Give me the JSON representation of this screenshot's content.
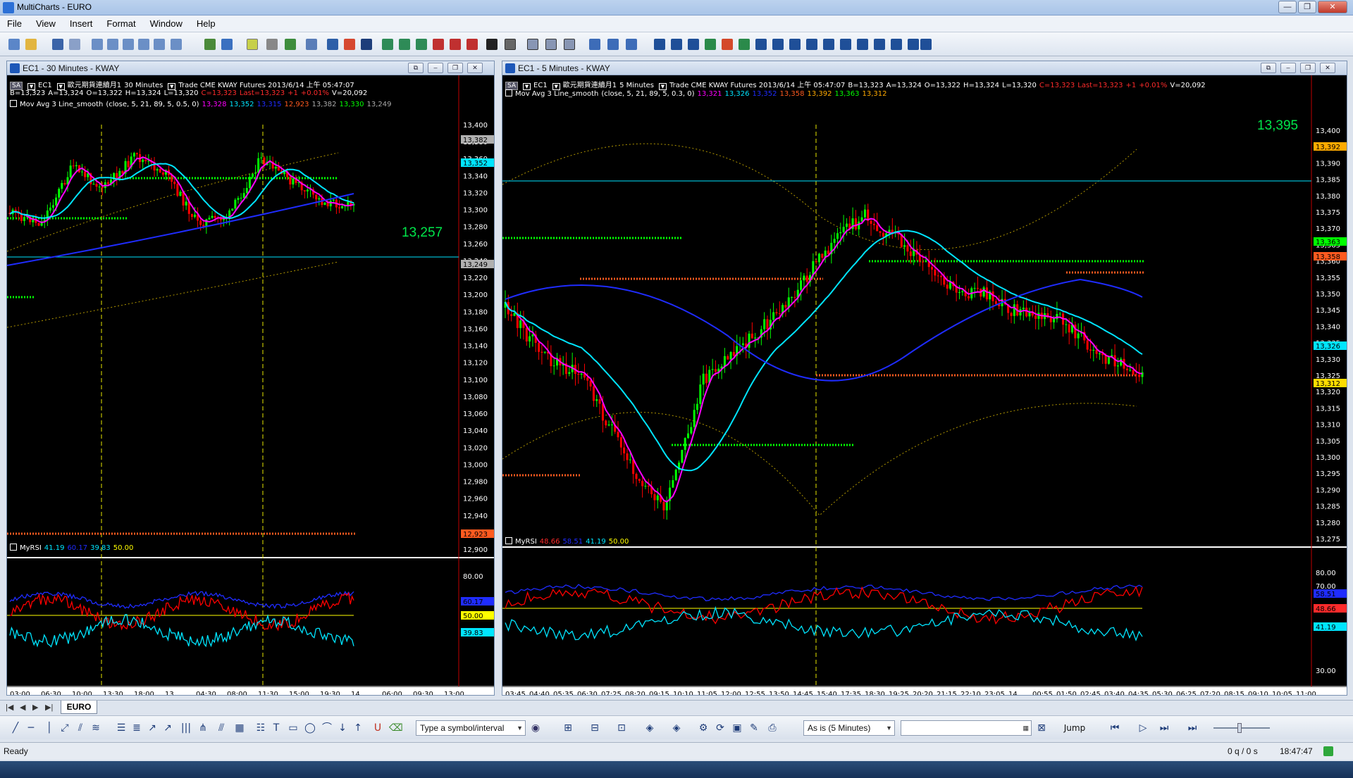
{
  "app": {
    "title": "MultiCharts - EURO"
  },
  "menu": [
    "File",
    "View",
    "Insert",
    "Format",
    "Window",
    "Help"
  ],
  "colors": {
    "chart_bg": "#000000",
    "price_up": "#00ff00",
    "price_down": "#ff0000",
    "ma_fast": "#ff00ff",
    "ma_mid": "#00e5ff",
    "ma_slow": "#1f2cff",
    "highlight_line": "#00ff00",
    "orange_line": "#ff5a1f",
    "dotted_band": "#b09600",
    "rsi_level": "#ffff00"
  },
  "left_chart": {
    "window_title": "EC1 - 30 Minutes - KWAY",
    "header_symbol": "EC1",
    "header_name": "歐元期貨連續月1",
    "header_interval": "30 Minutes",
    "header_rest": "Trade  CME  KWAY  Futures  2013/6/14  上午 05:47:07",
    "quote_b": "B=13,323",
    "quote_a": "A=13,324",
    "quote_o": "O=13,322",
    "quote_h": "H=13,324",
    "quote_l": "L=13,320",
    "quote_c": "C=13,323",
    "quote_last": "Last=13,323",
    "quote_chg": "+1",
    "quote_pct": "+0.01%",
    "quote_v": "V=20,092",
    "study_label": "Mov Avg 3 Line_smooth",
    "study_params": "(close,  5,  21,  89,  5,  0.5,  0)",
    "study_values": [
      "13,328",
      "13,352",
      "13,315",
      "12,923",
      "13,382",
      "13,330",
      "13,249"
    ],
    "big_price": "13,257",
    "y_ticks": [
      "13,400",
      "13,380",
      "13,360",
      "13,340",
      "13,320",
      "13,300",
      "13,280",
      "13,260",
      "13,240",
      "13,220",
      "13,200",
      "13,180",
      "13,160",
      "13,140",
      "13,120",
      "13,100",
      "13,080",
      "13,060",
      "13,040",
      "13,020",
      "13,000",
      "12,980",
      "12,960",
      "12,940",
      "12,920",
      "12,900"
    ],
    "y_tags": [
      "13,382",
      "13,352",
      "13,249",
      "12,923"
    ],
    "x_ticks": [
      "03:00",
      "06:30",
      "10:00",
      "13:30",
      "18:00",
      "13",
      "04:30",
      "08:00",
      "11:30",
      "15:00",
      "19:30",
      "14",
      "06:00",
      "09:30",
      "13:00"
    ],
    "rsi": {
      "label": "MyRSI",
      "values": [
        "41.19",
        "60.17",
        "39.83",
        "50.00"
      ],
      "y_ticks": [
        "80.00"
      ],
      "tags": [
        "60.17",
        "50.00",
        "39.83"
      ]
    }
  },
  "right_chart": {
    "window_title": "EC1 - 5 Minutes - KWAY",
    "header_symbol": "EC1",
    "header_name": "歐元期貨連續月1",
    "header_interval": "5 Minutes",
    "header_rest": "Trade  CME  KWAY  Futures  2013/6/14  上午 05:47:07",
    "quote_b": "B=13,323",
    "quote_a": "A=13,324",
    "quote_o": "O=13,322",
    "quote_h": "H=13,324",
    "quote_l": "L=13,320",
    "quote_c": "C=13,323",
    "quote_last": "Last=13,323",
    "quote_chg": "+1",
    "quote_pct": "+0.01%",
    "quote_v": "V=20,092",
    "study_label": "Mov Avg 3 Line_smooth",
    "study_params": "(close,  5,  21,  89,  5,  0.3,  0)",
    "study_values": [
      "13,321",
      "13,326",
      "13,352",
      "13,358",
      "13,392",
      "13,363",
      "13,312"
    ],
    "big_price": "13,395",
    "y_ticks": [
      "13,400",
      "13,395",
      "13,390",
      "13,385",
      "13,380",
      "13,375",
      "13,370",
      "13,365",
      "13,360",
      "13,355",
      "13,350",
      "13,345",
      "13,340",
      "13,335",
      "13,330",
      "13,325",
      "13,320",
      "13,315",
      "13,310",
      "13,305",
      "13,300",
      "13,295",
      "13,290",
      "13,285",
      "13,280",
      "13,275"
    ],
    "y_tags": [
      "13,392",
      "13,363",
      "13,358",
      "13,326",
      "13,312"
    ],
    "x_ticks": [
      "03:45",
      "04:40",
      "05:35",
      "06:30",
      "07:25",
      "08:20",
      "09:15",
      "10:10",
      "11:05",
      "12:00",
      "12:55",
      "13:50",
      "14:45",
      "15:40",
      "17:35",
      "18:30",
      "19:25",
      "20:20",
      "21:15",
      "22:10",
      "23:05",
      "14",
      "00:55",
      "01:50",
      "02:45",
      "03:40",
      "04:35",
      "05:30",
      "06:25",
      "07:20",
      "08:15",
      "09:10",
      "10:05",
      "11:00"
    ],
    "rsi": {
      "label": "MyRSI",
      "values": [
        "48.66",
        "58.51",
        "41.19",
        "50.00"
      ],
      "y_ticks": [
        "80.00",
        "70.00",
        "30.00"
      ],
      "tags": [
        "58.51",
        "48.66",
        "41.19"
      ]
    }
  },
  "sheet_tab": "EURO",
  "drawbar": {
    "symbol_placeholder": "Type a symbol/interval",
    "interval_select": "As is (5 Minutes)",
    "jump_label": "Jump"
  },
  "status": {
    "left": "Ready",
    "queue": "0 q / 0 s",
    "time": "18:47:47"
  }
}
